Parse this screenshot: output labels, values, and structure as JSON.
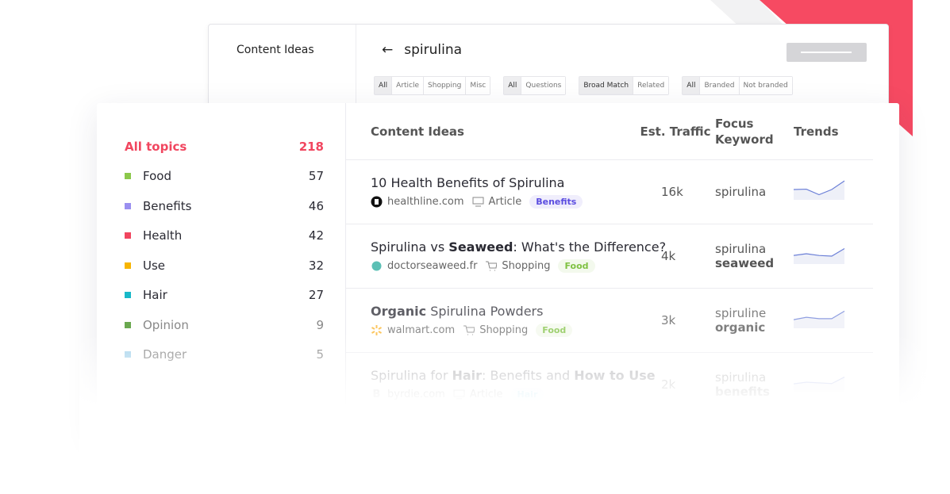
{
  "colors": {
    "accent": "#f1465f",
    "benefits": "#5b4de0",
    "food": "#7fc142",
    "hair": "#5fc7e0"
  },
  "back_panel": {
    "sidebar_title": "Content Ideas",
    "query": "spirulina",
    "filter_groups": [
      [
        "All",
        "Article",
        "Shopping",
        "Misc"
      ],
      [
        "All",
        "Questions"
      ],
      [
        "Broad Match",
        "Related"
      ],
      [
        "All",
        "Branded",
        "Not branded"
      ]
    ],
    "active": [
      "All",
      "All",
      "Broad Match",
      "All"
    ]
  },
  "topics": [
    {
      "label": "All topics",
      "count": "218",
      "color": ""
    },
    {
      "label": "Food",
      "count": "57",
      "color": "#8cc84b"
    },
    {
      "label": "Benefits",
      "count": "46",
      "color": "#9a8ff0"
    },
    {
      "label": "Health",
      "count": "42",
      "color": "#f1465f"
    },
    {
      "label": "Use",
      "count": "32",
      "color": "#f7b500"
    },
    {
      "label": "Hair",
      "count": "27",
      "color": "#18b8c8"
    },
    {
      "label": "Opinion",
      "count": "9",
      "color": "#6aa84f"
    },
    {
      "label": "Danger",
      "count": "5",
      "color": "#a8d4ec"
    }
  ],
  "table": {
    "headers": [
      "Content Ideas",
      "Est. Traffic",
      "Focus Keyword",
      "Trends"
    ],
    "rows": [
      {
        "title_parts": [
          [
            "10 Health Benefits of Spirulina",
            false
          ]
        ],
        "site": "healthline.com",
        "site_icon": "healthline-logo",
        "type": "Article",
        "type_icon": "monitor-icon",
        "tag": "Benefits",
        "tag_color": "#5b4de0",
        "traffic": "16k",
        "kw": [
          "spirulina",
          ""
        ],
        "trend": [
          3,
          3.1,
          1.5,
          3,
          5.5
        ]
      },
      {
        "title_parts": [
          [
            "Spirulina vs ",
            false
          ],
          [
            "Seaweed",
            true
          ],
          [
            ": What's the Difference?",
            false
          ]
        ],
        "site": "doctorseaweed.fr",
        "site_icon": "doctorseaweed-logo",
        "type": "Shopping",
        "type_icon": "cart-icon",
        "tag": "Food",
        "tag_color": "#7fc142",
        "traffic": "4k",
        "kw": [
          "spirulina",
          "seaweed"
        ],
        "trend": [
          2.5,
          3,
          2.5,
          2.3,
          4.5
        ]
      },
      {
        "title_parts": [
          [
            "Organic",
            true
          ],
          [
            " Spirulina Powders",
            false
          ]
        ],
        "site": "walmart.com",
        "site_icon": "walmart-logo",
        "type": "Shopping",
        "type_icon": "cart-icon",
        "tag": "Food",
        "tag_color": "#7fc142",
        "traffic": "3k",
        "kw": [
          "spiruline",
          "organic"
        ],
        "trend": [
          2.5,
          3.2,
          2.8,
          2.8,
          5
        ]
      },
      {
        "title_parts": [
          [
            "Spirulina for ",
            false
          ],
          [
            "Hair",
            true
          ],
          [
            ": Benefits and ",
            false
          ],
          [
            "How to Use",
            true
          ]
        ],
        "site": "byrdie.com",
        "site_icon": "byrdie-logo",
        "type": "Article",
        "type_icon": "monitor-icon",
        "tag": "Hair",
        "tag_color": "#5fc7e0",
        "traffic": "2k",
        "kw": [
          "spirulina",
          "benefits"
        ],
        "trend": [
          2.5,
          3,
          2.8,
          2.6,
          4.5
        ]
      }
    ]
  }
}
